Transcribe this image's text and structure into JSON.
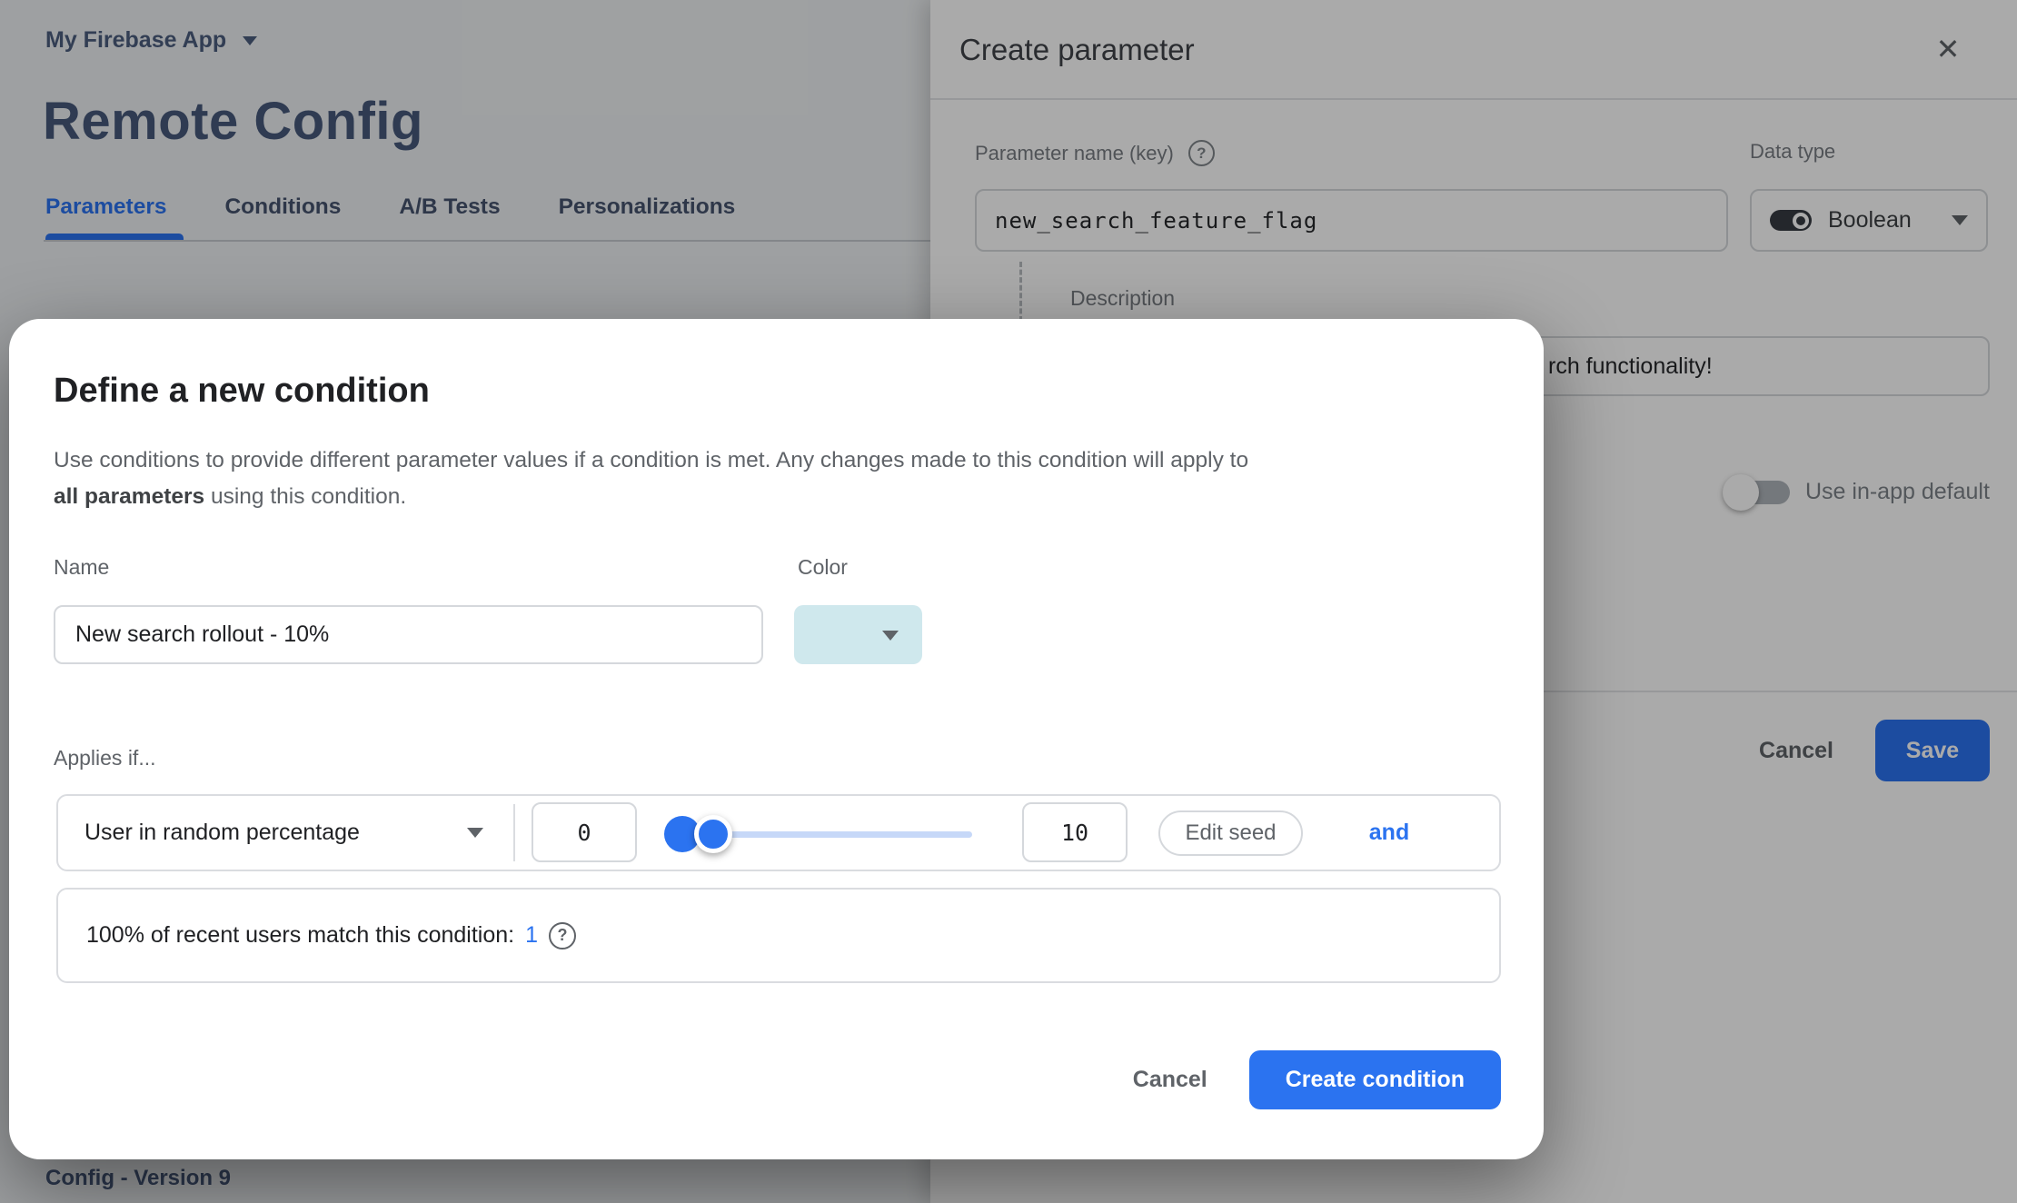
{
  "accent_color": "#2b73f0",
  "header": {
    "project_name": "My Firebase App",
    "page_title": "Remote Config"
  },
  "tabs": [
    {
      "label": "Parameters",
      "active": true
    },
    {
      "label": "Conditions",
      "active": false
    },
    {
      "label": "A/B Tests",
      "active": false
    },
    {
      "label": "Personalizations",
      "active": false
    }
  ],
  "footer": {
    "version_text": "Config - Version 9"
  },
  "panel": {
    "title": "Create parameter",
    "param_name_label": "Parameter name (key)",
    "param_name_value": "new_search_feature_flag",
    "data_type_label": "Data type",
    "data_type_value": "Boolean",
    "description_label": "Description",
    "description_visible_text": "rch functionality!",
    "use_in_app_default_label": "Use in-app default",
    "cancel_label": "Cancel",
    "save_label": "Save"
  },
  "modal": {
    "title": "Define a new condition",
    "intro_line1": "Use conditions to provide different parameter values if a condition is met. Any changes made to this condition will apply to",
    "intro_bold": "all parameters",
    "intro_line2_rest": " using this condition.",
    "name_label": "Name",
    "name_value": "New search rollout - 10%",
    "color_label": "Color",
    "color_swatch": "#cfe8ed",
    "applies_if_label": "Applies if...",
    "condition": {
      "type_value": "User in random percentage",
      "min_value": "0",
      "max_value": "10",
      "edit_seed_label": "Edit seed",
      "and_label": "and"
    },
    "match_info": {
      "text": "100% of recent users match this condition:",
      "value": "1"
    },
    "cancel_label": "Cancel",
    "create_label": "Create condition"
  },
  "icons": {
    "close": "✕",
    "help": "?"
  }
}
